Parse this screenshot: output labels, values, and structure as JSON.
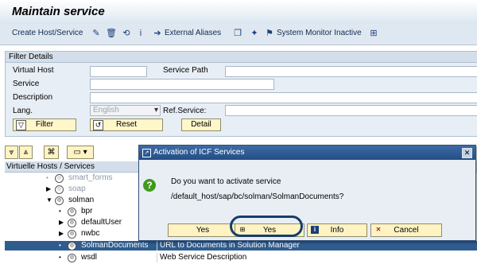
{
  "title": "Maintain service",
  "toolbar": {
    "create_label": "Create Host/Service",
    "external_aliases": "External Aliases",
    "system_monitor": "System Monitor Inactive"
  },
  "filter": {
    "header": "Filter Details",
    "virtual_host": "Virtual Host",
    "service_path": "Service Path",
    "service": "Service",
    "description": "Description",
    "lang": "Lang.",
    "lang_value": "English",
    "ref_service": "Ref.Service:",
    "buttons": {
      "filter": "Filter",
      "reset": "Reset",
      "detail": "Detail"
    }
  },
  "tree": {
    "column_header": "Virtuelle Hosts / Services",
    "rows": [
      {
        "name": "smart_forms",
        "desc": ""
      },
      {
        "name": "soap",
        "desc": ""
      },
      {
        "name": "solman",
        "desc": ""
      },
      {
        "name": "bpr",
        "desc": ""
      },
      {
        "name": "defaultUser",
        "desc": ""
      },
      {
        "name": "nwbc",
        "desc": ""
      },
      {
        "name": "SolmanDocuments",
        "desc": "URL to Documents in Solution Manager"
      },
      {
        "name": "wsdl",
        "desc": "Web Service Description"
      }
    ]
  },
  "dialog": {
    "title": "Activation of ICF Services",
    "question": "Do you want to activate service",
    "path": "/default_host/sap/bc/solman/SolmanDocuments?",
    "buttons": {
      "yes": "Yes",
      "yes_all": "Yes",
      "info": "Info",
      "cancel": "Cancel"
    }
  }
}
